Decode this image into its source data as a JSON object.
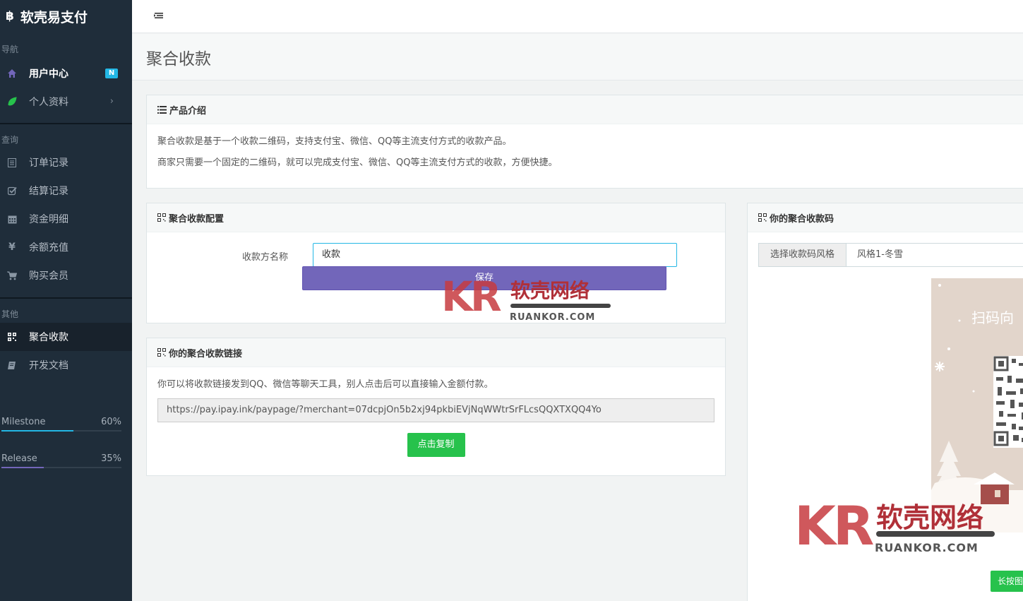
{
  "brand": {
    "logo": "฿",
    "name": "软壳易支付"
  },
  "sidebar": {
    "sections": [
      {
        "header": "导航",
        "items": [
          {
            "label": "用户中心",
            "icon": "home-icon",
            "badge": "N"
          },
          {
            "label": "个人资料",
            "icon": "leaf-icon",
            "chevron": "›"
          }
        ]
      },
      {
        "header": "查询",
        "items": [
          {
            "label": "订单记录",
            "icon": "list-icon"
          },
          {
            "label": "结算记录",
            "icon": "check-square-icon"
          },
          {
            "label": "资金明细",
            "icon": "calendar-icon"
          },
          {
            "label": "余额充值",
            "icon": "yen-icon"
          },
          {
            "label": "购买会员",
            "icon": "cart-icon"
          }
        ]
      },
      {
        "header": "其他",
        "items": [
          {
            "label": "聚合收款",
            "icon": "qrcode-icon"
          },
          {
            "label": "开发文档",
            "icon": "book-icon"
          }
        ]
      }
    ],
    "progress": [
      {
        "label": "Milestone",
        "value_text": "60%",
        "value": 0.6,
        "color": "#23b7e5"
      },
      {
        "label": "Release",
        "value_text": "35%",
        "value": 0.35,
        "color": "#7266ba"
      }
    ]
  },
  "page": {
    "title": "聚合收款"
  },
  "intro": {
    "heading": "产品介绍",
    "line1": "聚合收款是基于一个收款二维码，支持支付宝、微信、QQ等主流支付方式的收款产品。",
    "line2": "商家只需要一个固定的二维码，就可以完成支付宝、微信、QQ等主流支付方式的收款，方便快捷。"
  },
  "config": {
    "heading": "聚合收款配置",
    "name_label": "收款方名称",
    "name_value": "收款",
    "save_label": "保存"
  },
  "link": {
    "heading": "你的聚合收款链接",
    "description": "你可以将收款链接发到QQ、微信等聊天工具，别人点击后可以直接输入金额付款。",
    "url": "https://pay.ipay.ink/paypage/?merchant=07dcpjOn5b2xj94pkbiEVjNqWWtrSrFLcsQQXTXQQ4Yo",
    "copy_label": "点击复制"
  },
  "qrcode": {
    "heading": "你的聚合收款码",
    "style_label": "选择收款码风格",
    "style_value": "风格1-冬雪",
    "poster_title": "扫码向",
    "long_press_label": "长按图"
  },
  "watermark": {
    "kr": "KR",
    "cn": "软壳网络",
    "url": "RUANKOR.COM"
  }
}
